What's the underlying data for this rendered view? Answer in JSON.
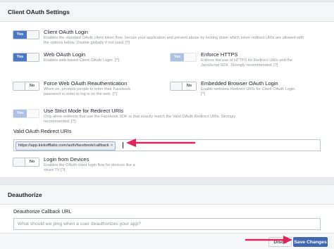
{
  "colors": {
    "accent": "#4267b2",
    "toggle_on": "#4a78c4",
    "annotation_arrow": "#e0245e",
    "panel_bg": "#ffffff",
    "page_bg": "#e9ebee"
  },
  "client_oauth": {
    "heading": "Client OAuth Settings",
    "settings": [
      {
        "title": "Client OAuth Login",
        "description": "Enables the standard OAuth client token flow. Secure your application and prevent abuse by locking down which token redirect URIs are allowed with the options below. Disable globally if not used.",
        "help": "[?]",
        "state": "Yes"
      },
      {
        "title": "Web OAuth Login",
        "description": "Enables web-based Client OAuth Login.",
        "help": "[?]",
        "state": "Yes"
      },
      {
        "title": "Enforce HTTPS",
        "description": "Enforce the use of HTTPS for Redirect URIs and the JavaScript SDK. Strongly recommended.",
        "help": "[?]",
        "state": "Yes"
      },
      {
        "title": "Force Web OAuth Reauthentication",
        "description": "When on, prompts people to enter their Facebook password in order to log in on the web.",
        "help": "[?]",
        "state": "No"
      },
      {
        "title": "Embedded Browser OAuth Login",
        "description": "Enable webview Redirect URIs for Client OAuth Login.",
        "help": "[?]",
        "state": "No"
      },
      {
        "title": "Use Strict Mode for Redirect URIs",
        "description": "Only allow redirects that use the Facebook SDK or that exactly match the Valid OAuth Redirect URIs. Strongly recommended.",
        "help": "[?]",
        "state": "Yes"
      }
    ],
    "redirect_uris": {
      "label": "Valid OAuth Redirect URIs",
      "values": [
        "https://app.kickofflabs.com/auth/facebook/callback"
      ],
      "remove_glyph": "×"
    },
    "login_from_devices": {
      "title": "Login from Devices",
      "description": "Enables the OAuth client login flow for devices like a smart TV",
      "help": "[?]",
      "state": "No"
    }
  },
  "deauthorize": {
    "heading": "Deauthorize",
    "callback_label": "Deauthorize Callback URL",
    "callback_placeholder": "What should we ping when a user deauthorizes your app?",
    "callback_value": ""
  },
  "footer": {
    "discard_label": "Disca",
    "save_label": "Save Changes"
  }
}
